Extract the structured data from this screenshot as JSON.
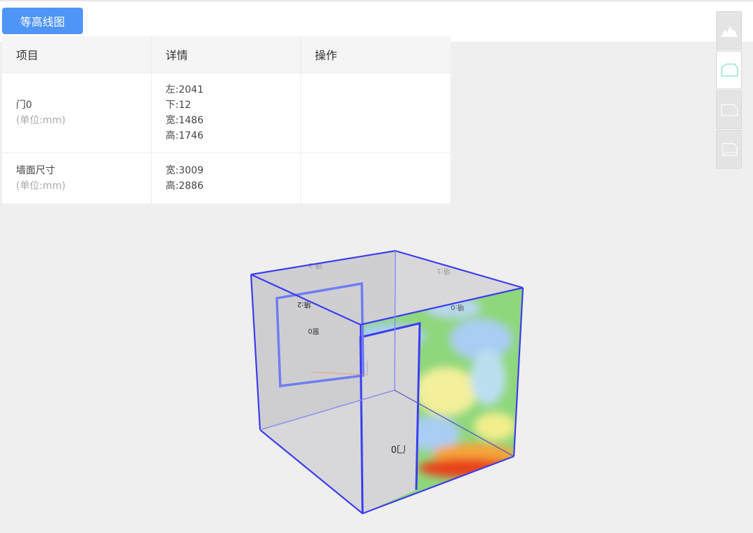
{
  "toolbar": {
    "contour_label": "等高线图"
  },
  "table": {
    "headers": [
      "项目",
      "详情",
      "操作"
    ],
    "rows": [
      {
        "item": "门0",
        "unit": "(单位:mm)",
        "details": [
          "左:2041",
          "下:12",
          "宽:1486",
          "高:1746"
        ]
      },
      {
        "item": "墙面尺寸",
        "unit": "(单位:mm)",
        "details": [
          "宽:3009",
          "高:2886"
        ]
      }
    ]
  },
  "side_tools": [
    {
      "icon": "mountain-icon",
      "active": false
    },
    {
      "icon": "room-outline-icon",
      "active": true
    },
    {
      "icon": "wall-face-icon",
      "active": false
    },
    {
      "icon": "wall-face-alt-icon",
      "active": false
    }
  ],
  "scene": {
    "labels": {
      "door": "门0",
      "window": "窗0",
      "wall_2": "墙:2",
      "wall_3": "墙:3",
      "wall_1": "墙:1",
      "wall_0": "墙:0"
    },
    "colors": {
      "edge": "#3c3cf0",
      "face": "#c8c8c8",
      "heat_high": "#e8421f",
      "heat_mid": "#f2ee8c",
      "heat_low": "#7fd67a",
      "heat_cool": "#9bc6f2"
    }
  }
}
